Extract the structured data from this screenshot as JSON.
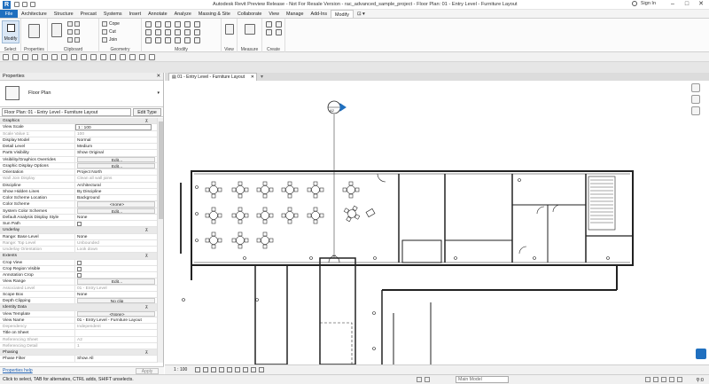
{
  "window": {
    "title": "Autodesk Revit Preview Release - Not For Resale Version - rac_advanced_sample_project - Floor Plan: 01 - Entry Level - Furniture Layout",
    "signin": "Sign In",
    "logo": "R"
  },
  "ribbon_tabs": [
    "File",
    "Architecture",
    "Structure",
    "Precast",
    "Systems",
    "Insert",
    "Annotate",
    "Analyze",
    "Massing & Site",
    "Collaborate",
    "View",
    "Manage",
    "Add-Ins",
    "Modify"
  ],
  "ribbon": {
    "modify_label": "Modify",
    "select_label": "Select",
    "properties_label": "Properties",
    "clipboard_label": "Clipboard",
    "geometry_label": "Geometry",
    "modify_panel_label": "Modify",
    "view_label": "View",
    "measure_label": "Measure",
    "create_label": "Create",
    "cope_label": "Cope",
    "cut_label": "Cut",
    "join_label": "Join"
  },
  "properties": {
    "header": "Properties",
    "type_name": "Floor Plan",
    "instance_selector": "Floor Plan: 01 - Entry Level - Furniture Layout",
    "edit_type": "Edit Type",
    "help_link": "Properties help",
    "apply": "Apply",
    "rows": [
      {
        "k": "Graphics",
        "v": "",
        "kind": "group"
      },
      {
        "k": "View Scale",
        "v": "1 : 100",
        "kind": "field"
      },
      {
        "k": "Scale Value    1:",
        "v": "100",
        "kind": "dim"
      },
      {
        "k": "Display Model",
        "v": "Normal",
        "kind": "normal"
      },
      {
        "k": "Detail Level",
        "v": "Medium",
        "kind": "normal"
      },
      {
        "k": "Parts Visibility",
        "v": "Show Original",
        "kind": "normal"
      },
      {
        "k": "Visibility/Graphics Overrides",
        "v": "Edit...",
        "kind": "btn"
      },
      {
        "k": "Graphic Display Options",
        "v": "Edit...",
        "kind": "btn"
      },
      {
        "k": "Orientation",
        "v": "Project North",
        "kind": "normal"
      },
      {
        "k": "Wall Join Display",
        "v": "Clean all wall joins",
        "kind": "dim"
      },
      {
        "k": "Discipline",
        "v": "Architectural",
        "kind": "normal"
      },
      {
        "k": "Show Hidden Lines",
        "v": "By Discipline",
        "kind": "normal"
      },
      {
        "k": "Color Scheme Location",
        "v": "Background",
        "kind": "normal"
      },
      {
        "k": "Color Scheme",
        "v": "<none>",
        "kind": "btn"
      },
      {
        "k": "System Color Schemes",
        "v": "Edit...",
        "kind": "btn"
      },
      {
        "k": "Default Analysis Display Style",
        "v": "None",
        "kind": "normal"
      },
      {
        "k": "Sun Path",
        "v": "",
        "kind": "check"
      },
      {
        "k": "Underlay",
        "v": "",
        "kind": "group"
      },
      {
        "k": "Range: Base Level",
        "v": "None",
        "kind": "normal"
      },
      {
        "k": "Range: Top Level",
        "v": "Unbounded",
        "kind": "dim"
      },
      {
        "k": "Underlay Orientation",
        "v": "Look down",
        "kind": "dim"
      },
      {
        "k": "Extents",
        "v": "",
        "kind": "group"
      },
      {
        "k": "Crop View",
        "v": "",
        "kind": "check"
      },
      {
        "k": "Crop Region Visible",
        "v": "",
        "kind": "check"
      },
      {
        "k": "Annotation Crop",
        "v": "",
        "kind": "check"
      },
      {
        "k": "View Range",
        "v": "Edit...",
        "kind": "btn"
      },
      {
        "k": "Associated Level",
        "v": "01 - Entry Level",
        "kind": "dim"
      },
      {
        "k": "Scope Box",
        "v": "None",
        "kind": "normal"
      },
      {
        "k": "Depth Clipping",
        "v": "No clip",
        "kind": "btn"
      },
      {
        "k": "Identity Data",
        "v": "",
        "kind": "group"
      },
      {
        "k": "View Template",
        "v": "<None>",
        "kind": "btn"
      },
      {
        "k": "View Name",
        "v": "01 - Entry Level - Furniture Layout",
        "kind": "normal"
      },
      {
        "k": "Dependency",
        "v": "Independent",
        "kind": "dim"
      },
      {
        "k": "Title on Sheet",
        "v": "",
        "kind": "normal"
      },
      {
        "k": "Referencing Sheet",
        "v": "A2",
        "kind": "dim"
      },
      {
        "k": "Referencing Detail",
        "v": "1",
        "kind": "dim"
      },
      {
        "k": "Phasing",
        "v": "",
        "kind": "group"
      },
      {
        "k": "Phase Filter",
        "v": "Show All",
        "kind": "normal"
      }
    ]
  },
  "view": {
    "tab_title": "01 - Entry Level - Furniture Layout",
    "scale": "1 : 100",
    "section_tag": "A2"
  },
  "status": {
    "message": "Click to select, TAB for alternates, CTRL adds, SHIFT unselects.",
    "model": "Main Model",
    "filter": ":0"
  }
}
